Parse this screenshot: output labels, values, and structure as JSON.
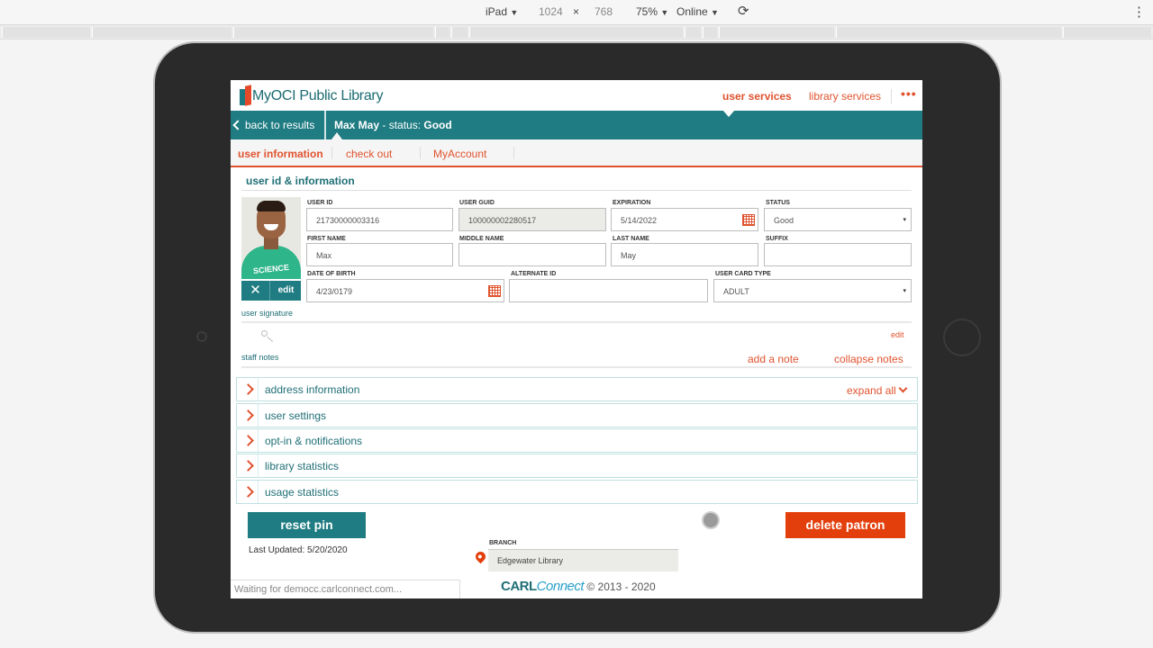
{
  "devtools": {
    "device": "iPad",
    "device_caret": "▼",
    "width": "1024",
    "times": "×",
    "height": "768",
    "zoom": "75%",
    "network": "Online",
    "rotate_glyph": "⟳",
    "more_glyph": "⋮"
  },
  "app": {
    "brand": "MyOCI Public Library",
    "nav": [
      "user services",
      "library services"
    ],
    "more": "•••",
    "back": "back to results",
    "patron_name": "Max May",
    "patron_status_label": " - status: ",
    "patron_status": "Good"
  },
  "tabs": [
    "user information",
    "check out",
    "MyAccount"
  ],
  "section_title": "user id & information",
  "photo_text": "SCIENCE",
  "photo_controls": {
    "remove": "✕",
    "edit": "edit"
  },
  "fields": {
    "user_id": {
      "label": "USER ID",
      "value": "21730000003316"
    },
    "user_guid": {
      "label": "USER GUID",
      "value": "100000002280517"
    },
    "expiration": {
      "label": "EXPIRATION",
      "value": "5/14/2022"
    },
    "status": {
      "label": "STATUS",
      "value": "Good"
    },
    "first_name": {
      "label": "FIRST NAME",
      "value": "Max"
    },
    "middle_name": {
      "label": "MIDDLE NAME",
      "value": ""
    },
    "last_name": {
      "label": "LAST NAME",
      "value": "May"
    },
    "suffix": {
      "label": "SUFFIX",
      "value": ""
    },
    "dob": {
      "label": "DATE OF BIRTH",
      "value": "4/23/0179"
    },
    "alternate_id": {
      "label": "ALTERNATE ID",
      "value": ""
    },
    "card_type": {
      "label": "USER CARD TYPE",
      "value": "ADULT"
    }
  },
  "caret": "▾",
  "signature": {
    "label": "user signature",
    "edit": "edit"
  },
  "notes": {
    "label": "staff notes",
    "add": "add a note",
    "collapse": "collapse notes"
  },
  "expand_all": "expand all",
  "accordions": [
    "address information",
    "user settings",
    "opt-in & notifications",
    "library statistics",
    "usage statistics"
  ],
  "actions": {
    "reset_pin": "reset pin",
    "delete_patron": "delete patron"
  },
  "last_updated": "Last Updated: 5/20/2020",
  "branch": {
    "label": "BRANCH",
    "value": "Edgewater Library"
  },
  "status_bar": "Waiting for democc.carlconnect.com...",
  "footer": {
    "carl": "CARL",
    "connect": "Connect",
    "copy": " © 2013 - 2020"
  }
}
